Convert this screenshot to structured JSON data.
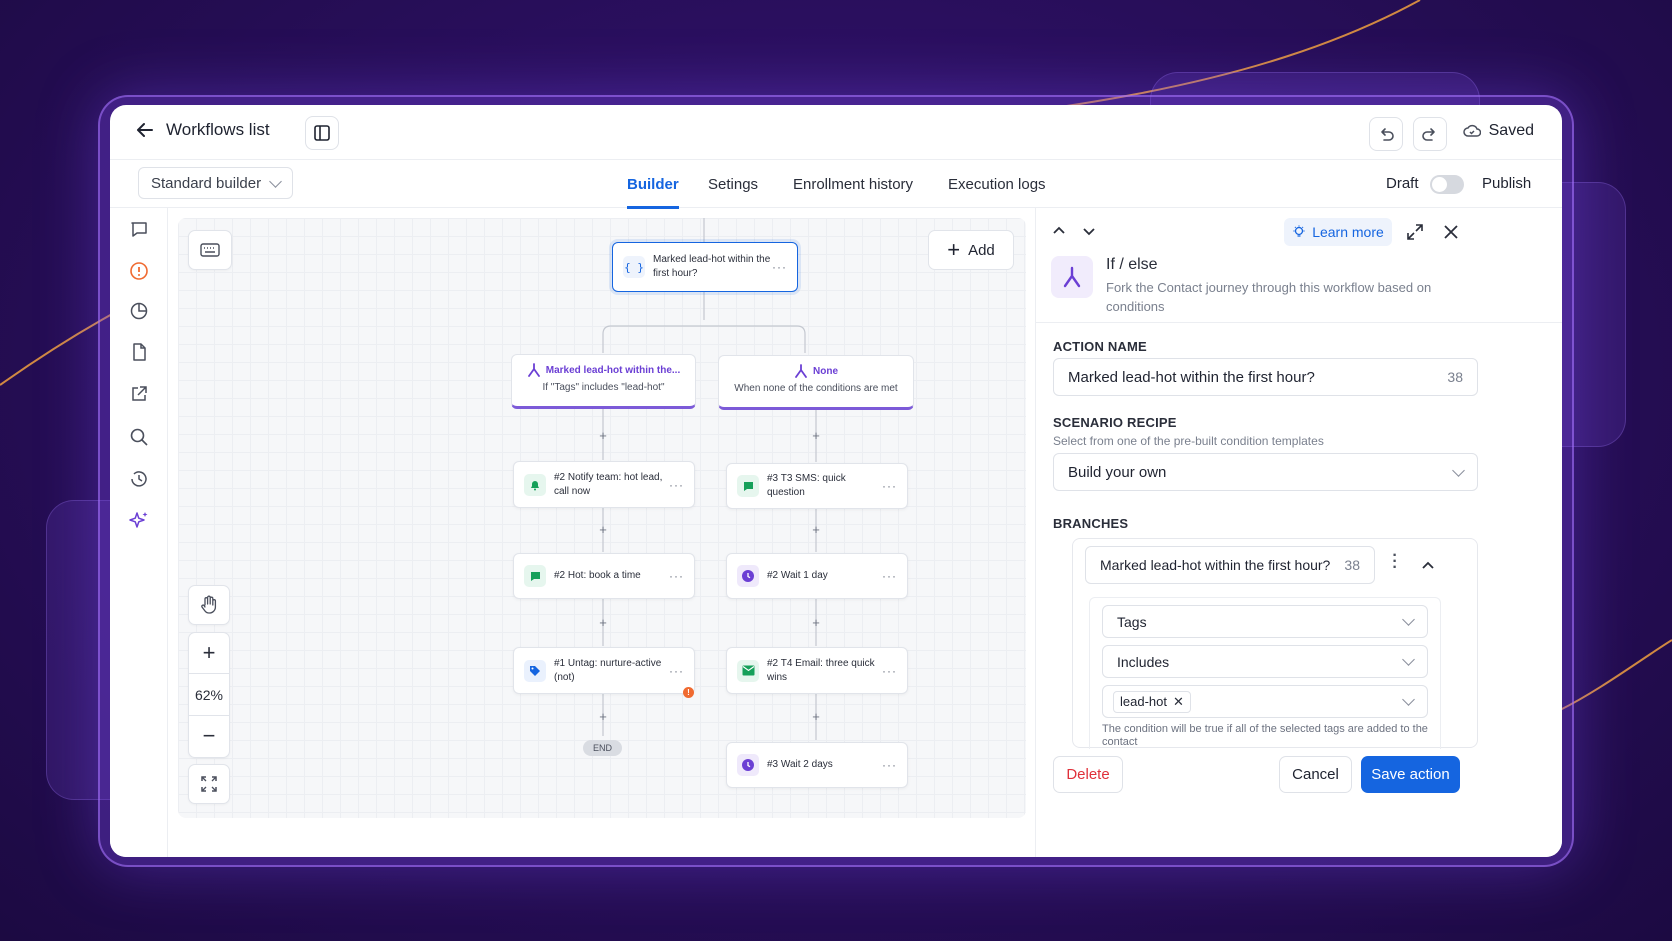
{
  "colors": {
    "accent": "#1565e0",
    "brand_purple": "#6b3fd4",
    "delete_red": "#e0303a",
    "warning_orange": "#f06a30",
    "green_icon": "#16a05a"
  },
  "topbar": {
    "back_label": "Workflows list",
    "saved_label": "Saved"
  },
  "tabbar": {
    "builder_select": "Standard builder",
    "tabs": [
      "Builder",
      "Setings",
      "Enrollment history",
      "Execution logs"
    ],
    "active_tab": "Builder",
    "draft_label": "Draft",
    "publish_label": "Publish"
  },
  "canvas": {
    "add_label": "Add",
    "zoom": "62%",
    "root": {
      "label": "Marked lead-hot within the first hour?",
      "icon": "braces-icon"
    },
    "branches": [
      {
        "title": "Marked lead-hot within the...",
        "subtitle": "If \"Tags\" includes \"lead-hot\""
      },
      {
        "title": "None",
        "subtitle": "When none of the conditions are met"
      }
    ],
    "left_steps": [
      {
        "label": "#2 Notify team: hot lead, call now",
        "icon": "bell-icon"
      },
      {
        "label": "#2 Hot: book a time",
        "icon": "sms-icon"
      },
      {
        "label": "#1 Untag: nurture-active (not)",
        "icon": "tag-icon",
        "warning": "!"
      }
    ],
    "right_steps": [
      {
        "label": "#3 T3 SMS: quick question",
        "icon": "sms-icon"
      },
      {
        "label": "#2 Wait 1 day",
        "icon": "clock-icon"
      },
      {
        "label": "#2 T4 Email: three quick wins",
        "icon": "mail-icon"
      },
      {
        "label": "#3 Wait 2 days",
        "icon": "clock-icon"
      }
    ],
    "end_label": "END"
  },
  "panel": {
    "learn_more": "Learn more",
    "title": "If / else",
    "description": "Fork the Contact journey through this workflow based on conditions",
    "action_name_label": "ACTION NAME",
    "action_name_value": "Marked lead-hot within the first hour?",
    "action_name_count": "38",
    "scenario_label": "SCENARIO RECIPE",
    "scenario_help": "Select from one of the pre-built condition templates",
    "scenario_value": "Build your own",
    "branches_label": "BRANCHES",
    "branch_name": "Marked lead-hot within the first hour?",
    "branch_count": "38",
    "condition_field": "Tags",
    "condition_operator": "Includes",
    "condition_tag": "lead-hot",
    "condition_help": "The condition will be true if all of the selected tags are added to the contact",
    "delete_label": "Delete",
    "cancel_label": "Cancel",
    "save_label": "Save action"
  }
}
